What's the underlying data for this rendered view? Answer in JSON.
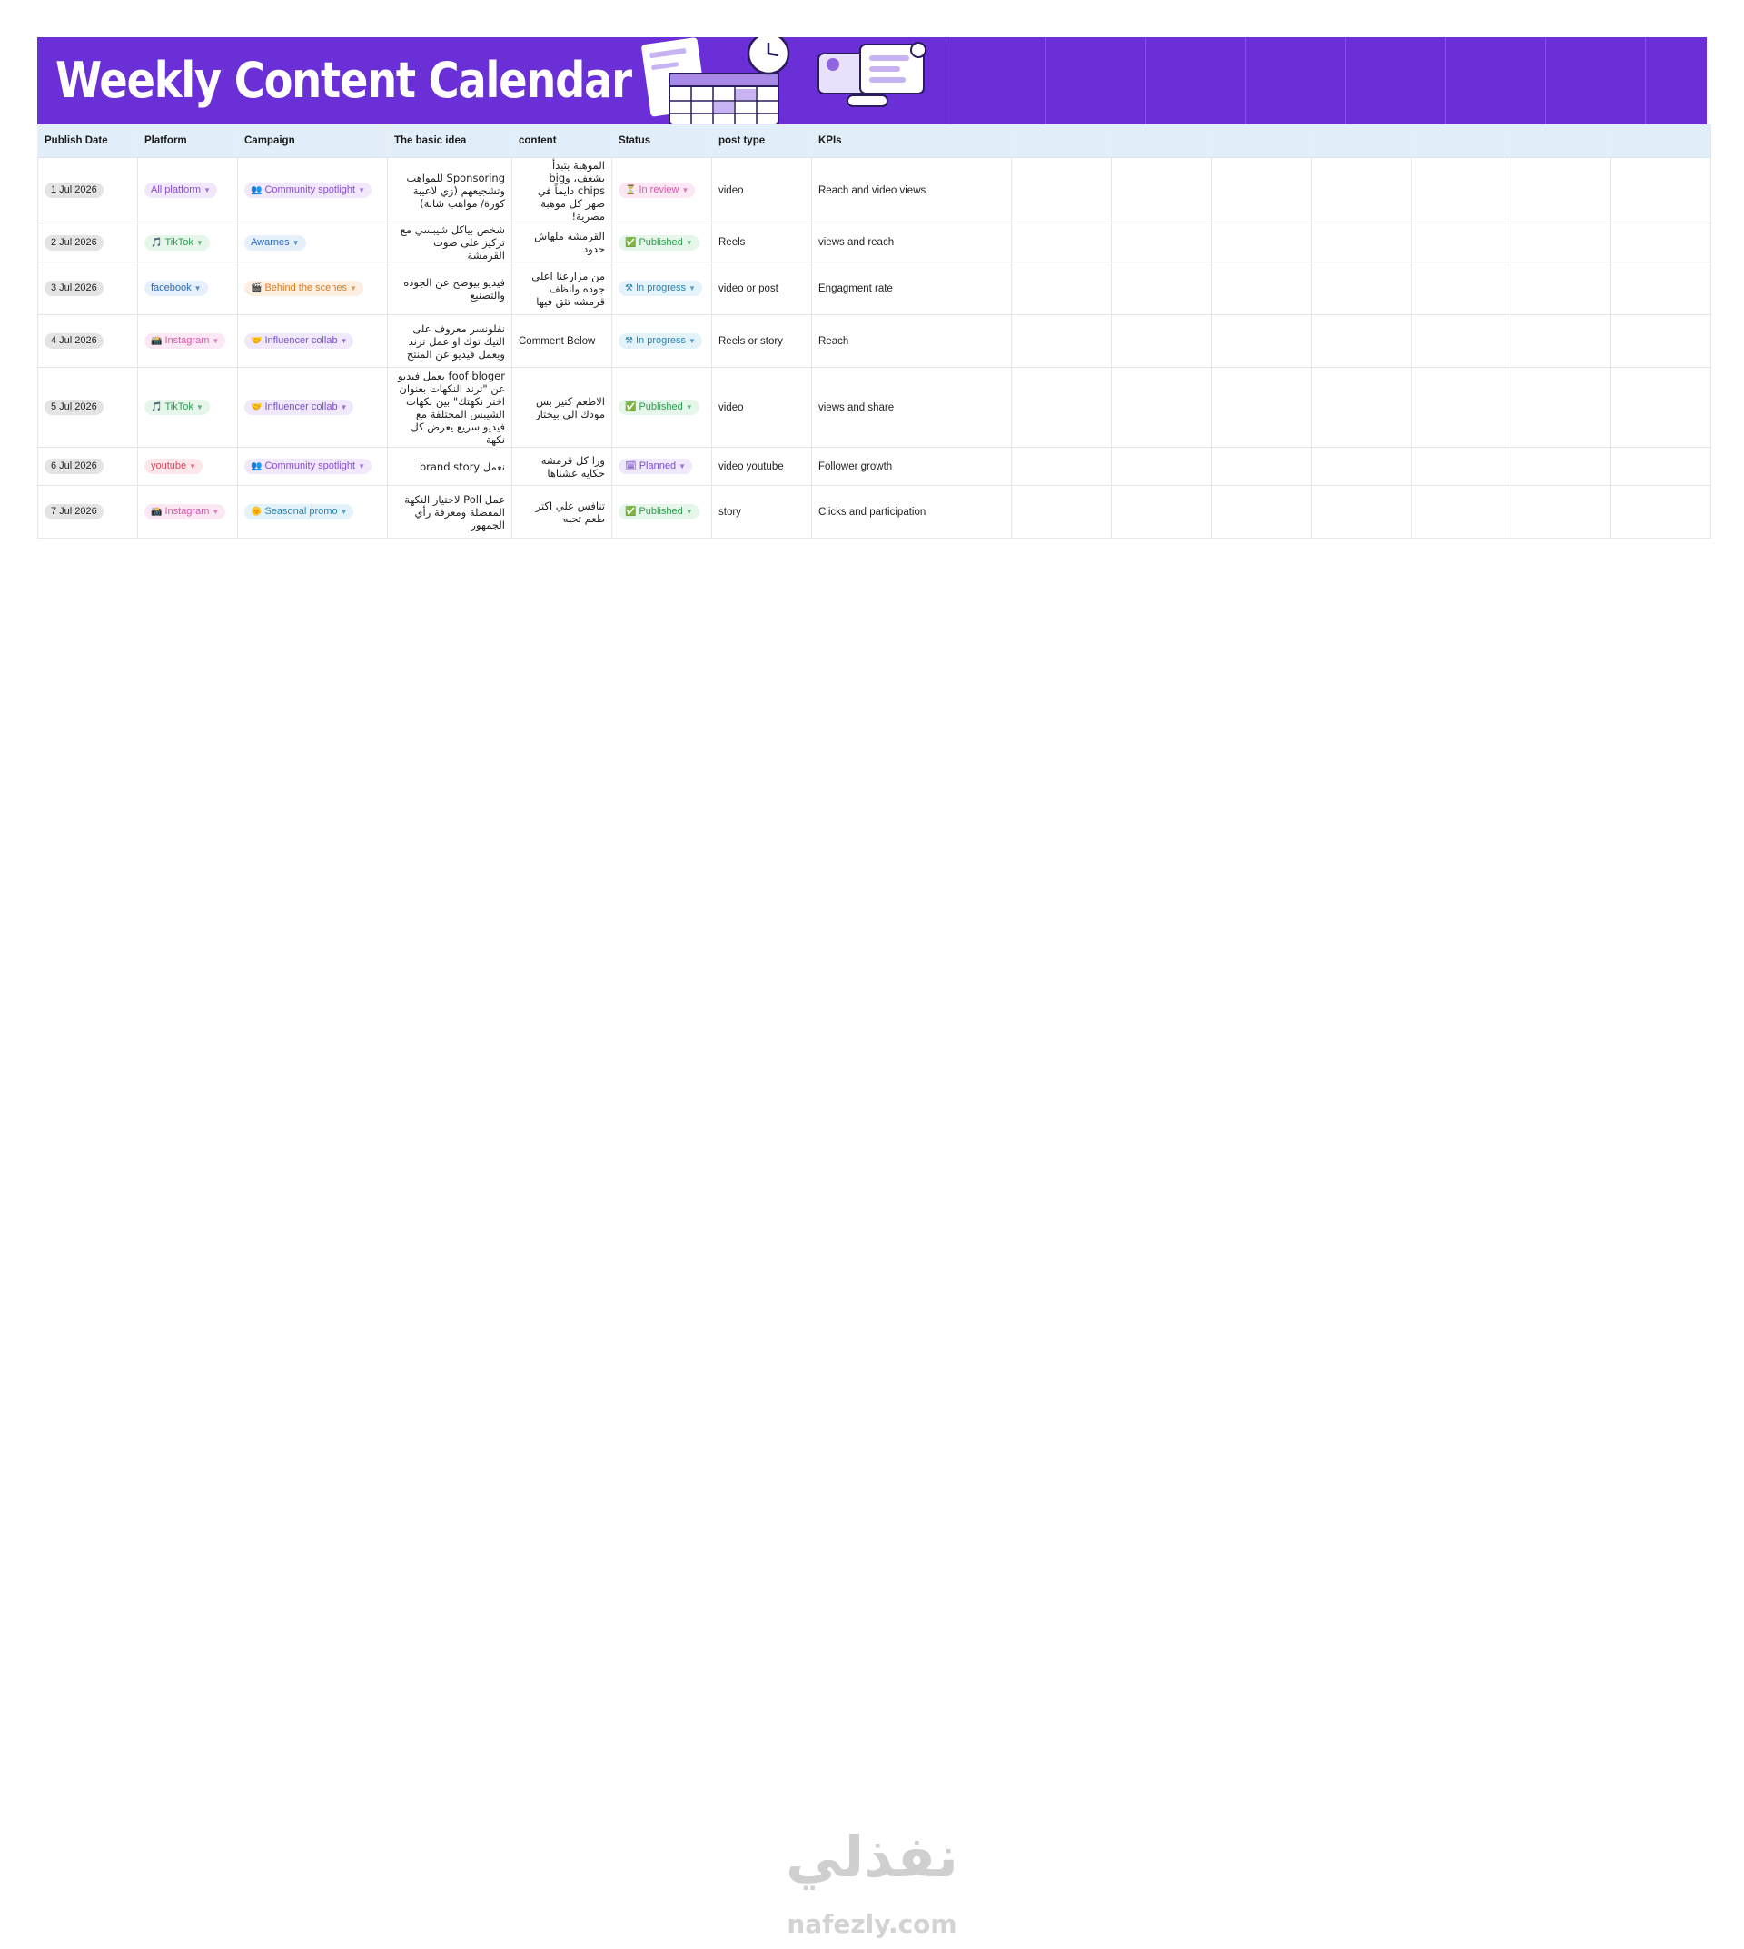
{
  "banner": {
    "title": "Weekly Content Calendar"
  },
  "colors": {
    "banner": "#6a2fd6",
    "header_row": "#e2effb"
  },
  "table": {
    "headers": [
      "Publish Date",
      "Platform",
      "Campaign",
      "The basic idea",
      "content",
      "Status",
      "post type",
      "KPIs"
    ],
    "rows": [
      {
        "date": "1 Jul 2026",
        "platform": {
          "icon": "",
          "label": "All platform",
          "color": "purple"
        },
        "campaign": {
          "icon": "👥",
          "label": "Community spotlight",
          "color": "purple"
        },
        "idea": "Sponsoring للمواهب وتشجيعهم (زي لاعيبة كورة/ مواهب شابة)",
        "content": "الموهبة بتبدأ بشغف، وbig chips دايماً في ضهر كل موهبة مصرية!",
        "status": {
          "icon": "⏳",
          "label": "In review",
          "color": "pink"
        },
        "post_type": "video",
        "kpis": "Reach and video views"
      },
      {
        "date": "2 Jul 2026",
        "platform": {
          "icon": "🎵",
          "label": "TikTok",
          "color": "green"
        },
        "campaign": {
          "icon": "",
          "label": "Awarnes",
          "color": "blue"
        },
        "idea": "شخص بياكل شيبسي مع تركيز على صوت القرمشة",
        "content": "القرمشه ملهاش حدود",
        "status": {
          "icon": "✅",
          "label": "Published",
          "color": "green"
        },
        "post_type": "Reels",
        "kpis": "views and reach"
      },
      {
        "date": "3 Jul 2026",
        "platform": {
          "icon": "",
          "label": "facebook",
          "color": "blue"
        },
        "campaign": {
          "icon": "🎬",
          "label": "Behind the scenes",
          "color": "orange"
        },
        "idea": "فيديو بيوضح عن الجوده والتصنيع",
        "content": "من مزارعنا اعلى جوده وانظف قرمشه تثق فيها",
        "status": {
          "icon": "⚒",
          "label": "In progress",
          "color": "teal"
        },
        "post_type": "video or post",
        "kpis": "Engagment rate"
      },
      {
        "date": "4 Jul 2026",
        "platform": {
          "icon": "📸",
          "label": "Instagram",
          "color": "pink"
        },
        "campaign": {
          "icon": "🤝",
          "label": "Influencer collab",
          "color": "violet"
        },
        "idea": "نفلونسر معروف على التيك توك او عمل ترند ويعمل فيديو عن المنتج",
        "content": "Comment Below",
        "status": {
          "icon": "⚒",
          "label": "In progress",
          "color": "teal"
        },
        "post_type": "Reels or story",
        "kpis": "Reach"
      },
      {
        "date": "5 Jul 2026",
        "platform": {
          "icon": "🎵",
          "label": "TikTok",
          "color": "green"
        },
        "campaign": {
          "icon": "🤝",
          "label": "Influencer collab",
          "color": "violet"
        },
        "idea": "foof bloger يعمل فيديو عن \"ترند النكهات بعنوان اختر نكهتك\" بين نكهات الشيبس المختلفة مع فيديو سريع يعرض كل نكهة",
        "content": "الاطعم كتير بس مودك الي بيختار",
        "status": {
          "icon": "✅",
          "label": "Published",
          "color": "green"
        },
        "post_type": "video",
        "kpis": "views and share"
      },
      {
        "date": "6 Jul 2026",
        "platform": {
          "icon": "",
          "label": "youtube",
          "color": "red"
        },
        "campaign": {
          "icon": "👥",
          "label": "Community spotlight",
          "color": "purple"
        },
        "idea": "نعمل brand story",
        "content": "ورا كل قرمشه حكايه عشناها",
        "status": {
          "icon": "🗓",
          "label": "Planned",
          "color": "violet"
        },
        "post_type": "video youtube",
        "kpis": "Follower growth"
      },
      {
        "date": "7 Jul 2026",
        "platform": {
          "icon": "📸",
          "label": "Instagram",
          "color": "pink"
        },
        "campaign": {
          "icon": "🌞",
          "label": "Seasonal promo",
          "color": "teal"
        },
        "idea": "عمل Poll لاختيار النكهة المفضلة ومعرفة رأي الجمهور",
        "content": "تنافس علي اكتر طعم تحبه",
        "status": {
          "icon": "✅",
          "label": "Published",
          "color": "green"
        },
        "post_type": "story",
        "kpis": "Clicks and participation"
      }
    ]
  },
  "watermark": {
    "arabic": "نفذلي",
    "domain": "nafezly.com"
  }
}
